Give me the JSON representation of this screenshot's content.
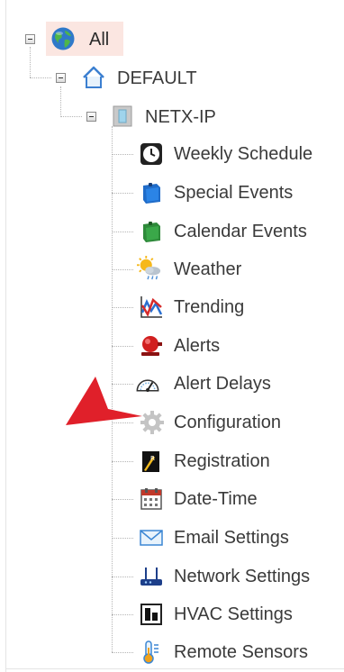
{
  "tree": {
    "root": {
      "label": "All",
      "icon": "globe-icon"
    },
    "group": {
      "label": "DEFAULT",
      "icon": "house-icon"
    },
    "device": {
      "label": "NETX-IP",
      "icon": "device-icon"
    },
    "items": [
      {
        "label": "Weekly Schedule",
        "icon": "clock-icon"
      },
      {
        "label": "Special Events",
        "icon": "blue-binder-icon"
      },
      {
        "label": "Calendar Events",
        "icon": "green-binder-icon"
      },
      {
        "label": "Weather",
        "icon": "weather-icon"
      },
      {
        "label": "Trending",
        "icon": "trend-chart-icon"
      },
      {
        "label": "Alerts",
        "icon": "alarm-bell-icon"
      },
      {
        "label": "Alert Delays",
        "icon": "gauge-icon"
      },
      {
        "label": "Configuration",
        "icon": "gear-icon"
      },
      {
        "label": "Registration",
        "icon": "registration-icon"
      },
      {
        "label": "Date-Time",
        "icon": "calendar-icon"
      },
      {
        "label": "Email Settings",
        "icon": "envelope-icon"
      },
      {
        "label": "Network Settings",
        "icon": "router-icon"
      },
      {
        "label": "HVAC Settings",
        "icon": "hvac-icon"
      },
      {
        "label": "Remote Sensors",
        "icon": "thermometer-icon"
      }
    ]
  },
  "annotation": {
    "icon": "red-pointer-arrow",
    "color": "#e0202a"
  },
  "colors": {
    "highlight": "#fbe6e1",
    "text": "#3a3a3a"
  }
}
